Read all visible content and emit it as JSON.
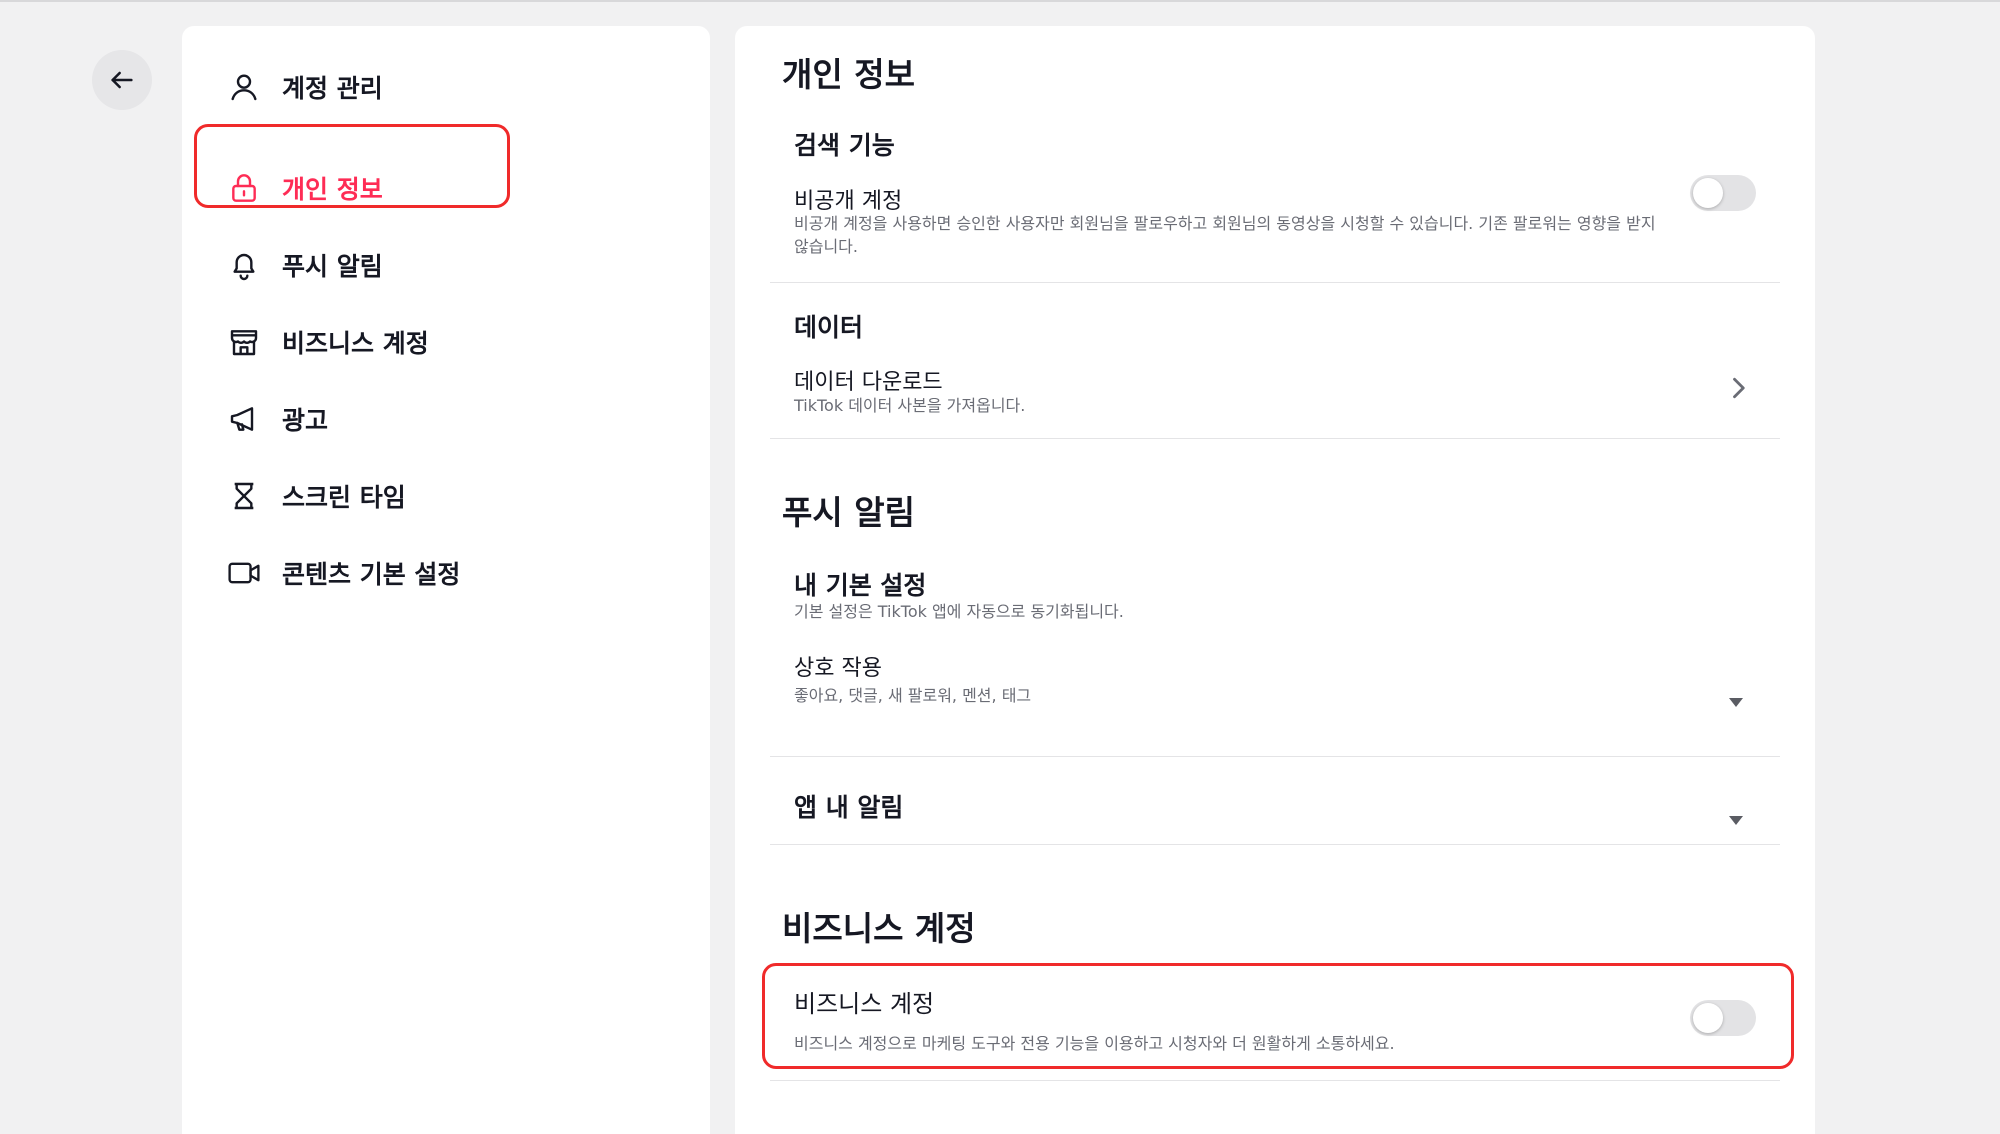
{
  "colors": {
    "accent": "#fe2c55",
    "highlight": "#f02a2a",
    "toggle_off": "#e3e3e5"
  },
  "sidebar": {
    "items": [
      {
        "label": "계정 관리",
        "icon": "person-icon"
      },
      {
        "label": "개인 정보",
        "icon": "lock-icon",
        "active": true
      },
      {
        "label": "푸시 알림",
        "icon": "bell-icon"
      },
      {
        "label": "비즈니스 계정",
        "icon": "store-icon"
      },
      {
        "label": "광고",
        "icon": "megaphone-icon"
      },
      {
        "label": "스크린 타임",
        "icon": "hourglass-icon"
      },
      {
        "label": "콘텐츠 기본 설정",
        "icon": "video-camera-icon"
      }
    ]
  },
  "privacy": {
    "title": "개인 정보",
    "search": {
      "title": "검색 기능",
      "private_account": {
        "title": "비공개 계정",
        "description": "비공개 계정을 사용하면 승인한 사용자만 회원님을 팔로우하고 회원님의 동영상을 시청할 수 있습니다. 기존 팔로워는 영향을 받지 않습니다.",
        "enabled": false
      }
    },
    "data": {
      "title": "데이터",
      "download": {
        "title": "데이터 다운로드",
        "description": "TikTok 데이터 사본을 가져옵니다."
      }
    }
  },
  "push": {
    "title": "푸시 알림",
    "preferences": {
      "title": "내 기본 설정",
      "description": "기본 설정은 TikTok 앱에 자동으로 동기화됩니다."
    },
    "interactions": {
      "title": "상호 작용",
      "description": "좋아요, 댓글, 새 팔로워, 멘션, 태그"
    },
    "in_app": {
      "title": "앱 내 알림"
    }
  },
  "business": {
    "title": "비즈니스 계정",
    "account": {
      "title": "비즈니스 계정",
      "description": "비즈니스 계정으로 마케팅 도구와 전용 기능을 이용하고 시청자와 더 원활하게 소통하세요.",
      "enabled": false
    }
  }
}
